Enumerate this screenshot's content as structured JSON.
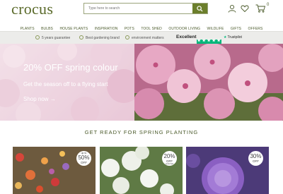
{
  "header": {
    "logo_text": "crocus",
    "search": {
      "placeholder": "Type here to search"
    },
    "cart_count": "0",
    "icons": [
      "account-icon",
      "heart-icon",
      "cart-icon",
      "search-icon"
    ]
  },
  "nav": {
    "items": [
      "PLANTS",
      "BULBS",
      "HOUSE PLANTS",
      "INSPIRATION",
      "POTS",
      "TOOL SHED",
      "OUTDOOR LIVING",
      "WILDLIFE",
      "GIFTS",
      "OFFERS"
    ]
  },
  "trust_bar": {
    "items": [
      "5 years guarantee",
      "Best gardening brand",
      "environment matters"
    ],
    "rating_word": "Excellent",
    "trustpilot_label": "Trustpilot"
  },
  "hero": {
    "title": "20% OFF spring colour",
    "subtitle": "Get the season off to a flying start",
    "cta": "Shop now"
  },
  "section": {
    "title": "GET READY FOR SPRING PLANTING"
  },
  "cards": [
    {
      "badge_top": "up to",
      "badge_pct": "50%",
      "badge_label": "OFF"
    },
    {
      "badge_top": "",
      "badge_pct": "20%",
      "badge_label": "OFF",
      "badge_sub": "selected"
    },
    {
      "badge_top": "",
      "badge_pct": "30%",
      "badge_label": "OFF"
    }
  ],
  "colors": {
    "brand_green": "#6b7e2b",
    "nav_text": "#4a5a2a",
    "trustpilot_green": "#00b67a"
  }
}
